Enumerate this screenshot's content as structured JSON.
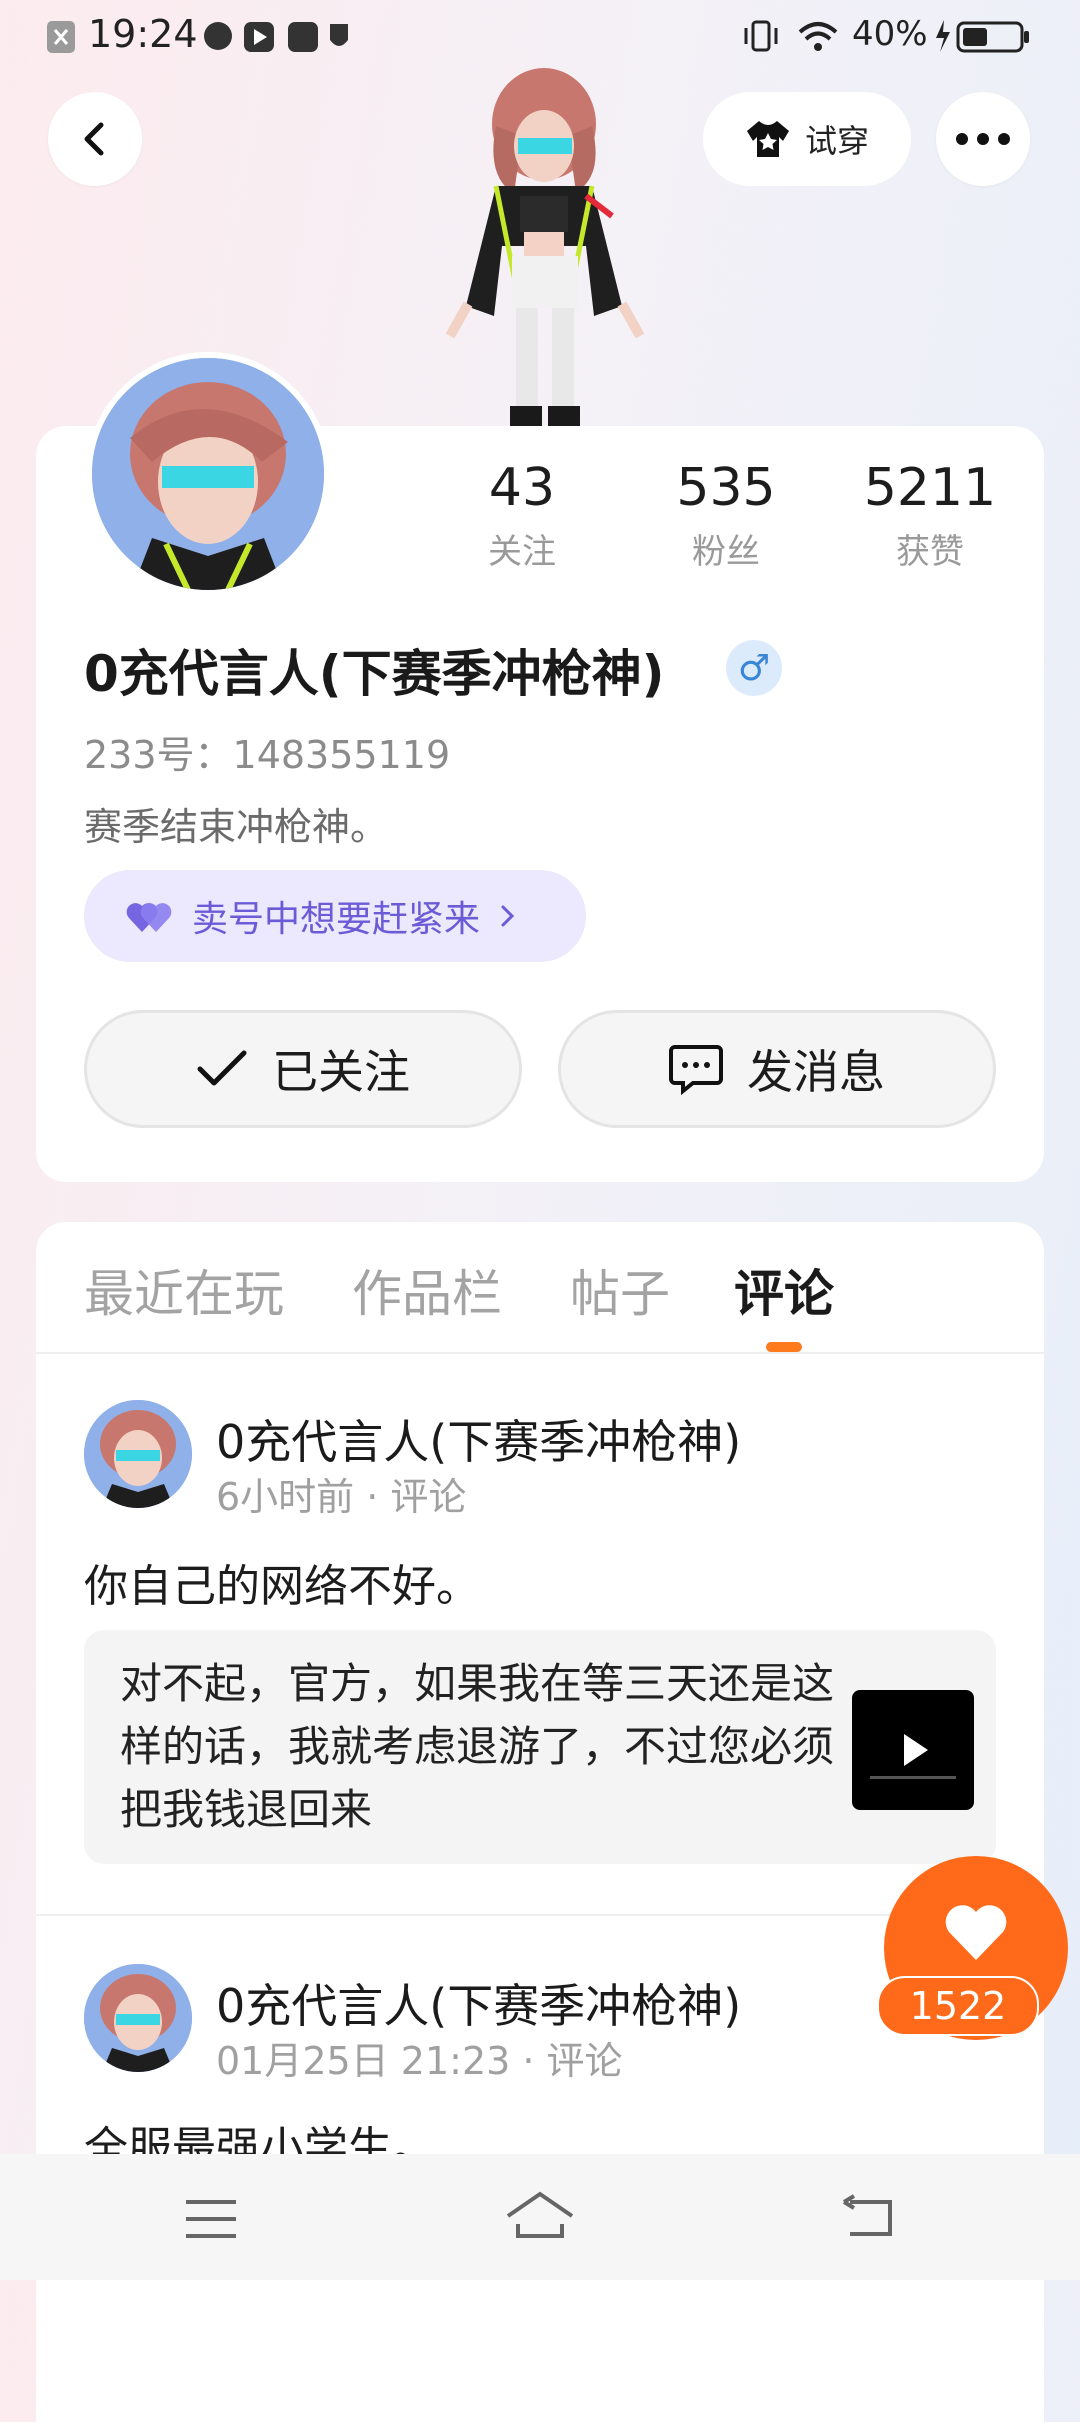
{
  "status_bar": {
    "time": "19:24",
    "battery_percent": "40%"
  },
  "header": {
    "try_on_label": "试穿"
  },
  "profile": {
    "stats": [
      {
        "value": "43",
        "label": "关注"
      },
      {
        "value": "535",
        "label": "粉丝"
      },
      {
        "value": "5211",
        "label": "获赞"
      }
    ],
    "name": "0充代言人(下赛季冲枪神)",
    "gender_symbol": "♂",
    "uid": "233号：148355119",
    "bio": "赛季结束冲枪神。",
    "promo_label": "卖号中想要赶紧来",
    "follow_button_label": "已关注",
    "message_button_label": "发消息"
  },
  "tabs": [
    {
      "label": "最近在玩",
      "active": false
    },
    {
      "label": "作品栏",
      "active": false
    },
    {
      "label": "帖子",
      "active": false
    },
    {
      "label": "评论",
      "active": true
    }
  ],
  "posts": [
    {
      "author": "0充代言人(下赛季冲枪神)",
      "meta": "6小时前 · 评论",
      "text": "你自己的网络不好。",
      "quote": "对不起，官方，如果我在等三天还是这样的话，我就考虑退游了，不过您必须把我钱退回来"
    },
    {
      "author": "0充代言人(下赛季冲枪神)",
      "meta": "01月25日 21:23 · 评论",
      "text": "全服最强小学生。"
    }
  ],
  "like_fab": {
    "count": "1522"
  },
  "colors": {
    "accent": "#ff6a1a",
    "promo_text": "#6b5bd6",
    "promo_bg": "#ece8fd"
  }
}
